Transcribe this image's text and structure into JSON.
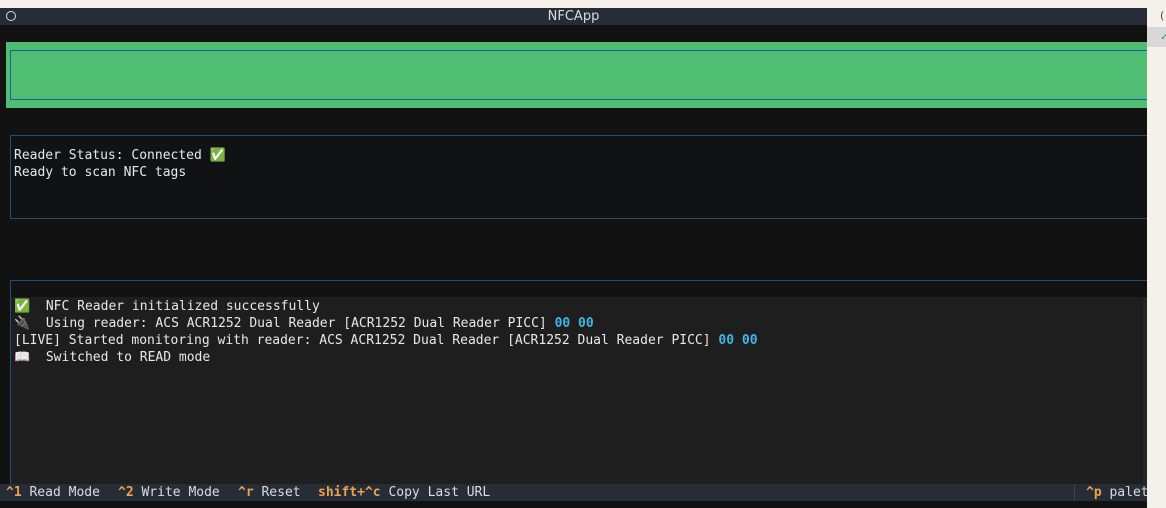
{
  "window": {
    "title": "NFCApp"
  },
  "status": {
    "line1": "Reader Status: Connected ✅",
    "line2": "Ready to scan NFC tags"
  },
  "log": {
    "entries": [
      {
        "text": "✅  NFC Reader initialized successfully",
        "hex": ""
      },
      {
        "text": "🔌  Using reader: ACS ACR1252 Dual Reader [ACR1252 Dual Reader PICC] ",
        "hex": "00 00"
      },
      {
        "text": "[LIVE] Started monitoring with reader: ACS ACR1252 Dual Reader [ACR1252 Dual Reader PICC] ",
        "hex": "00 00"
      },
      {
        "text": "📖  Switched to READ mode",
        "hex": ""
      }
    ]
  },
  "footer": {
    "bindings": [
      {
        "key": "^1",
        "label": " Read Mode"
      },
      {
        "key": "^2",
        "label": " Write Mode"
      },
      {
        "key": "^r",
        "label": " Reset"
      },
      {
        "key": "shift+^c",
        "label": " Copy Last URL"
      }
    ],
    "palette": {
      "key": "^p",
      "label": " palet"
    }
  },
  "side": {
    "fragment_top": "(",
    "fragment_selected": "✓"
  },
  "colors": {
    "banner": "#4fbd72",
    "hex": "#3fb6e8",
    "footer_key": "#f0a04b",
    "chrome": "#262d36"
  }
}
